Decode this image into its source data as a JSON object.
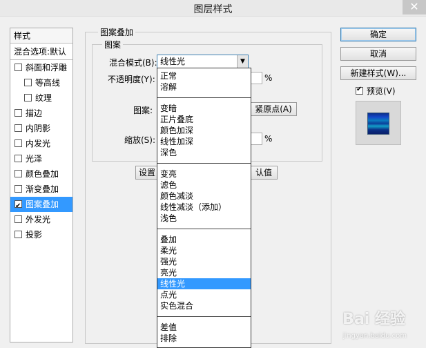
{
  "window": {
    "title": "图层样式",
    "close": "✕"
  },
  "style_list": {
    "header": "样式",
    "blend_options": "混合选项:默认",
    "items": [
      {
        "label": "斜面和浮雕",
        "checked": false,
        "sub": false
      },
      {
        "label": "等高线",
        "checked": false,
        "sub": true
      },
      {
        "label": "纹理",
        "checked": false,
        "sub": true
      },
      {
        "label": "描边",
        "checked": false,
        "sub": false
      },
      {
        "label": "内阴影",
        "checked": false,
        "sub": false
      },
      {
        "label": "内发光",
        "checked": false,
        "sub": false
      },
      {
        "label": "光泽",
        "checked": false,
        "sub": false
      },
      {
        "label": "颜色叠加",
        "checked": false,
        "sub": false
      },
      {
        "label": "渐变叠加",
        "checked": false,
        "sub": false
      },
      {
        "label": "图案叠加",
        "checked": true,
        "sub": false,
        "selected": true
      },
      {
        "label": "外发光",
        "checked": false,
        "sub": false
      },
      {
        "label": "投影",
        "checked": false,
        "sub": false
      }
    ]
  },
  "panel": {
    "group_title": "图案叠加",
    "subgroup_title": "图案",
    "blend_mode_label": "混合模式(B):",
    "blend_mode_value": "线性光",
    "opacity_label": "不透明度(Y):",
    "opacity_unit": "%",
    "pattern_label": "图案:",
    "snap_origin_button": "紧原点(A)",
    "scale_label": "缩放(S):",
    "scale_unit": "%",
    "set_default_button": "设置",
    "reset_default_button": "认值"
  },
  "buttons": {
    "ok": "确定",
    "cancel": "取消",
    "new_style": "新建样式(W)...",
    "preview_label": "预览(V)",
    "preview_checked": true
  },
  "dropdown": {
    "groups": [
      [
        "正常",
        "溶解"
      ],
      [
        "变暗",
        "正片叠底",
        "颜色加深",
        "线性加深",
        "深色"
      ],
      [
        "变亮",
        "滤色",
        "颜色减淡",
        "线性减淡（添加）",
        "浅色"
      ],
      [
        "叠加",
        "柔光",
        "强光",
        "亮光",
        "线性光",
        "点光",
        "实色混合"
      ],
      [
        "差值",
        "排除"
      ]
    ],
    "selected": "线性光"
  },
  "watermark": {
    "text": "Bai 经验",
    "sub": "jingyan.baidu.com"
  }
}
